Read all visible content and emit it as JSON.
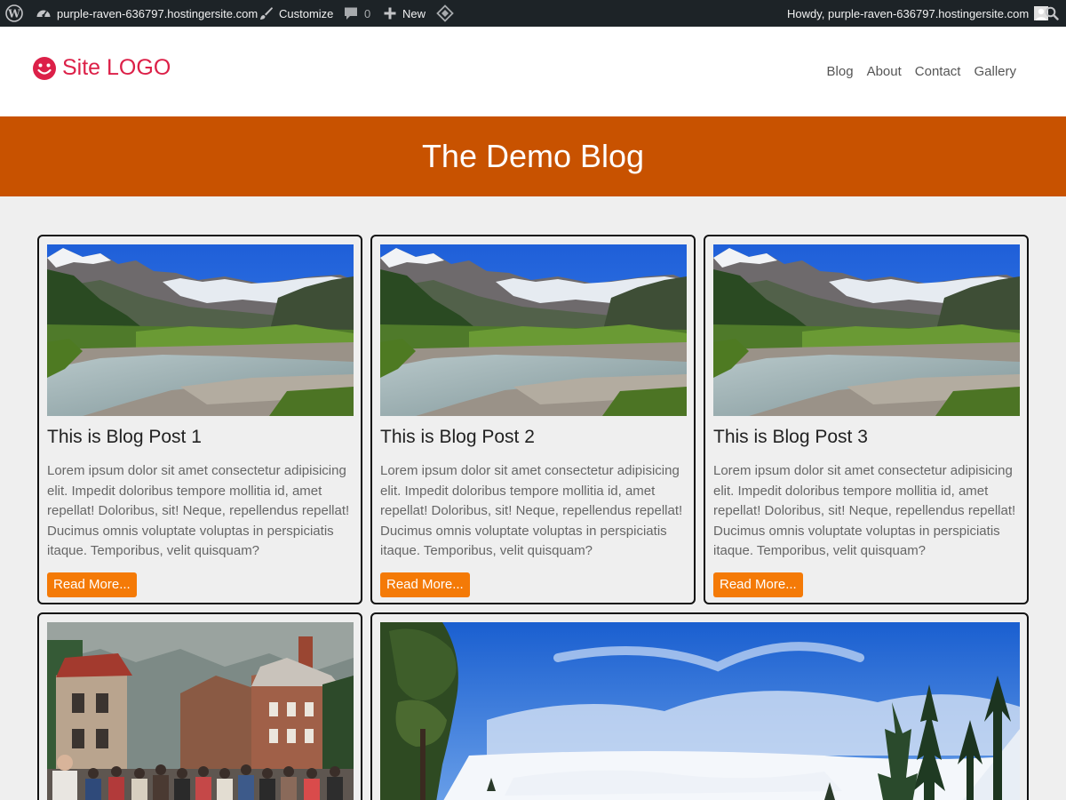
{
  "admin_bar": {
    "site_name": "purple-raven-636797.hostingersite.com",
    "customize": "Customize",
    "comment_count": "0",
    "new": "New",
    "howdy": "Howdy, purple-raven-636797.hostingersite.com",
    "icons": [
      "wordpress-icon",
      "dashboard-icon",
      "brush-icon",
      "comment-icon",
      "plus-icon",
      "diamond-icon",
      "avatar",
      "search-icon"
    ]
  },
  "header": {
    "logo_text": "Site LOGO",
    "logo_icon": "smiley-icon",
    "nav": [
      {
        "label": "Blog"
      },
      {
        "label": "About"
      },
      {
        "label": "Contact"
      },
      {
        "label": "Gallery"
      }
    ]
  },
  "banner": {
    "title": "The Demo Blog"
  },
  "posts": [
    {
      "title": "This is Blog Post 1",
      "excerpt": "Lorem ipsum dolor sit amet consectetur adipisicing elit. Impedit doloribus tempore mollitia id, amet repellat! Doloribus, sit! Neque, repellendus repellat! Ducimus omnis voluptate voluptas in perspiciatis itaque. Temporibus, velit quisquam?",
      "button": "Read More..."
    },
    {
      "title": "This is Blog Post 2",
      "excerpt": "Lorem ipsum dolor sit amet consectetur adipisicing elit. Impedit doloribus tempore mollitia id, amet repellat! Doloribus, sit! Neque, repellendus repellat! Ducimus omnis voluptate voluptas in perspiciatis itaque. Temporibus, velit quisquam?",
      "button": "Read More..."
    },
    {
      "title": "This is Blog Post 3",
      "excerpt": "Lorem ipsum dolor sit amet consectetur adipisicing elit. Impedit doloribus tempore mollitia id, amet repellat! Doloribus, sit! Neque, repellendus repellat! Ducimus omnis voluptate voluptas in perspiciatis itaque. Temporibus, velit quisquam?",
      "button": "Read More..."
    }
  ],
  "colors": {
    "admin_bar": "#1d2327",
    "logo": "#dc2048",
    "banner": "#c85200",
    "button": "#f47a07",
    "page_background": "#efefef"
  }
}
